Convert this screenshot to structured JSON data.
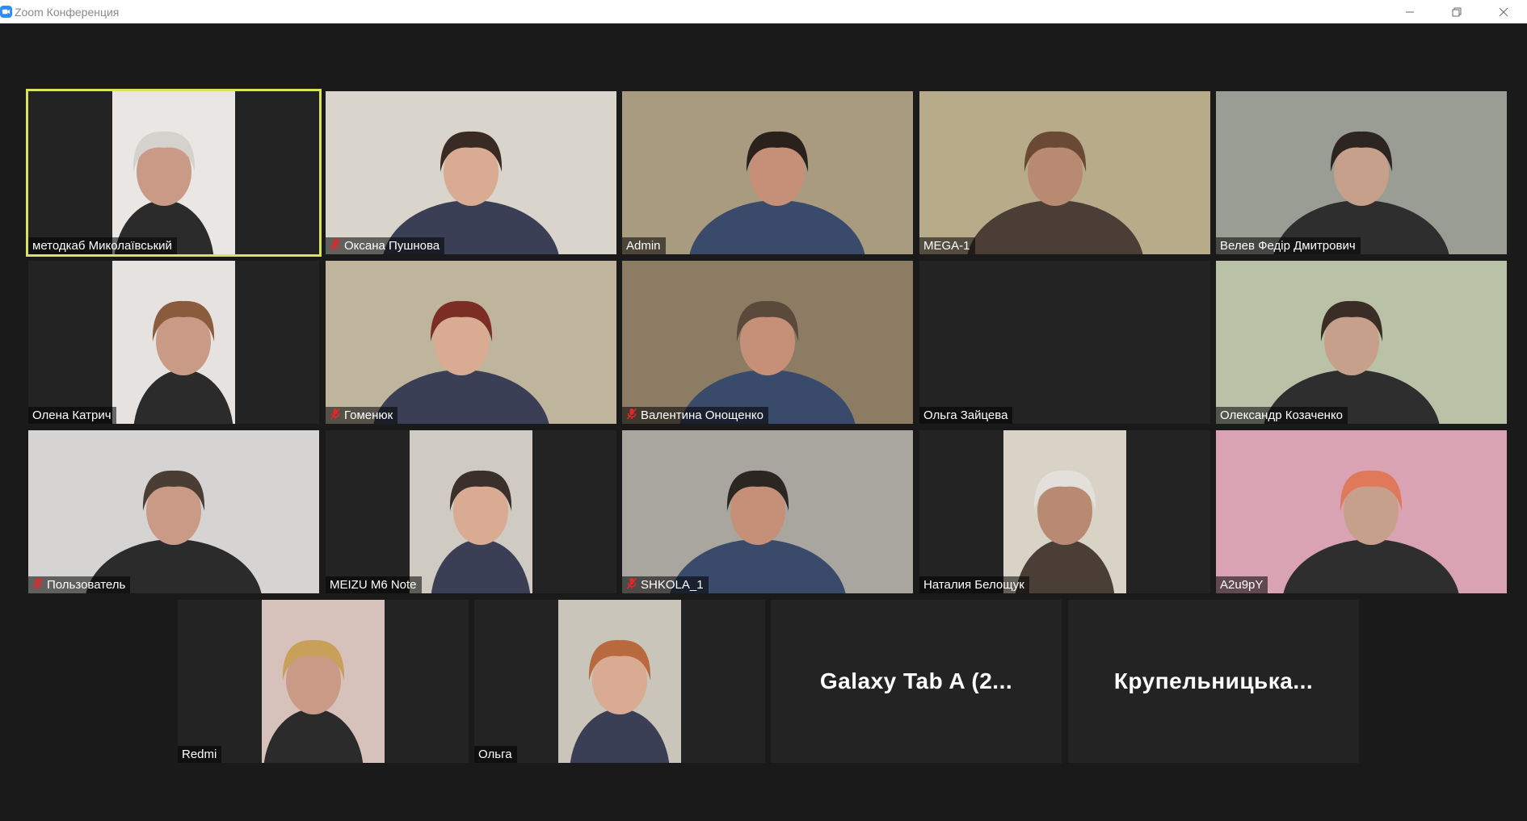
{
  "window": {
    "title": "Zoom Конференция"
  },
  "participants": [
    {
      "name": "методкаб Миколаївський",
      "muted": false,
      "active": true,
      "bg": "#e9e6e4"
    },
    {
      "name": "Оксана Пушнова",
      "muted": true,
      "active": false,
      "bg": "#d9d4cc"
    },
    {
      "name": "Admin",
      "muted": false,
      "active": false,
      "bg": "#a89b80"
    },
    {
      "name": "MEGA-1",
      "muted": false,
      "active": false,
      "bg": "#b7ab8a"
    },
    {
      "name": "Велев Федір Дмитрович",
      "muted": false,
      "active": false,
      "bg": "#9a9d94"
    },
    {
      "name": "Олена Катрич",
      "muted": false,
      "active": false,
      "bg": "#e6e2df"
    },
    {
      "name": "Гоменюк",
      "muted": true,
      "active": false,
      "bg": "#bfb49c"
    },
    {
      "name": "Валентина Онощенко",
      "muted": true,
      "active": false,
      "bg": "#8c7c64"
    },
    {
      "name": "Ольга Зайцева",
      "muted": false,
      "active": false,
      "bg": "#232323"
    },
    {
      "name": "Олександр Козаченко",
      "muted": false,
      "active": false,
      "bg": "#b9c2a6"
    },
    {
      "name": "Пользователь",
      "muted": true,
      "active": false,
      "bg": "#d6d4d2"
    },
    {
      "name": "MEIZU M6 Note",
      "muted": false,
      "active": false,
      "bg": "#cfcac2"
    },
    {
      "name": "SHKOLA_1",
      "muted": true,
      "active": false,
      "bg": "#a9a59f"
    },
    {
      "name": "Наталия Белощук",
      "muted": false,
      "active": false,
      "bg": "#d9d3c6"
    },
    {
      "name": "A2u9pY",
      "muted": false,
      "active": false,
      "bg": "#d9a3b3"
    },
    {
      "name": "Redmi",
      "muted": false,
      "active": false,
      "bg": "#d7c2bb"
    },
    {
      "name": "Ольга",
      "muted": false,
      "active": false,
      "bg": "#c9c5bb"
    },
    {
      "name": "Galaxy Tab A (2...",
      "muted": false,
      "active": false,
      "bg": "#232323"
    },
    {
      "name": "Крупельницька...",
      "muted": false,
      "active": false,
      "bg": "#232323"
    }
  ]
}
